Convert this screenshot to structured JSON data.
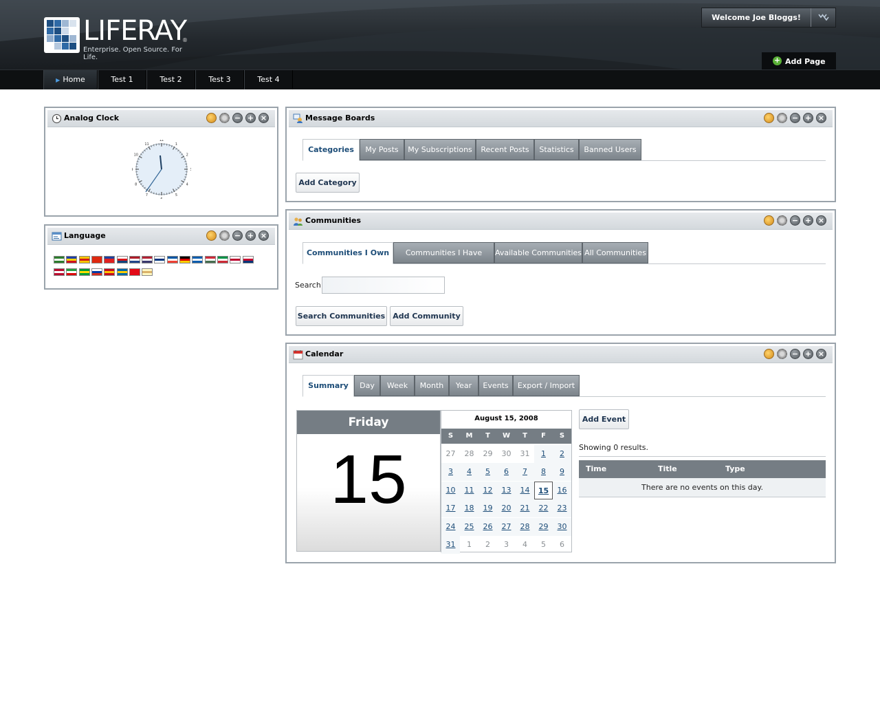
{
  "header": {
    "logo_text": "LIFERAY",
    "logo_reg": "®",
    "logo_tagline": "Enterprise. Open Source. For Life.",
    "welcome": "Welcome Joe Bloggs!",
    "add_page": "Add Page"
  },
  "nav": {
    "items": [
      {
        "label": "Home",
        "active": true
      },
      {
        "label": "Test 1"
      },
      {
        "label": "Test 2"
      },
      {
        "label": "Test 3"
      },
      {
        "label": "Test 4"
      }
    ]
  },
  "clock": {
    "title": "Analog Clock",
    "numbers": [
      "12",
      "1",
      "2",
      "3",
      "4",
      "5",
      "6",
      "7",
      "8",
      "9",
      "10",
      "11"
    ]
  },
  "language": {
    "title": "Language",
    "flags": [
      {
        "name": "flag-arabic",
        "colors": [
          "#2d7d2d",
          "#fff",
          "#2d7d2d"
        ]
      },
      {
        "name": "flag-catalan-andorra",
        "colors": [
          "#1f3fa6",
          "#f5d200",
          "#cf1020"
        ]
      },
      {
        "name": "flag-catalan",
        "colors": [
          "#f5c400",
          "#d21a1a",
          "#f5c400"
        ]
      },
      {
        "name": "flag-china",
        "colors": [
          "#de2910",
          "#de2910",
          "#de2910"
        ]
      },
      {
        "name": "flag-taiwan",
        "colors": [
          "#1d3fa0",
          "#e02020",
          "#e02020"
        ]
      },
      {
        "name": "flag-czech",
        "colors": [
          "#fff",
          "#d7141a",
          "#11457e"
        ]
      },
      {
        "name": "flag-netherlands",
        "colors": [
          "#ae1c28",
          "#fff",
          "#21468b"
        ]
      },
      {
        "name": "flag-usa",
        "colors": [
          "#b22234",
          "#fff",
          "#3c3b6e"
        ]
      },
      {
        "name": "flag-finland",
        "colors": [
          "#fff",
          "#003580",
          "#fff"
        ]
      },
      {
        "name": "flag-france",
        "colors": [
          "#0055a4",
          "#fff",
          "#ef4135"
        ]
      },
      {
        "name": "flag-germany",
        "colors": [
          "#000",
          "#dd0000",
          "#ffce00"
        ]
      },
      {
        "name": "flag-greece",
        "colors": [
          "#0d5eaf",
          "#fff",
          "#0d5eaf"
        ]
      },
      {
        "name": "flag-hungary",
        "colors": [
          "#ce2939",
          "#fff",
          "#477050"
        ]
      },
      {
        "name": "flag-italy",
        "colors": [
          "#009246",
          "#fff",
          "#ce2b37"
        ]
      },
      {
        "name": "flag-japan",
        "colors": [
          "#fff",
          "#bc002d",
          "#fff"
        ]
      },
      {
        "name": "flag-korea",
        "colors": [
          "#fff",
          "#c60c30",
          "#003478"
        ]
      },
      {
        "name": "flag-norway",
        "colors": [
          "#ba0c2f",
          "#fff",
          "#ba0c2f"
        ]
      },
      {
        "name": "flag-iran",
        "colors": [
          "#239f40",
          "#fff",
          "#da0000"
        ]
      },
      {
        "name": "flag-brazil",
        "colors": [
          "#009c3b",
          "#ffdf00",
          "#009c3b"
        ]
      },
      {
        "name": "flag-russia",
        "colors": [
          "#fff",
          "#0039a6",
          "#d52b1e"
        ]
      },
      {
        "name": "flag-spain",
        "colors": [
          "#c60b1e",
          "#ffc400",
          "#c60b1e"
        ]
      },
      {
        "name": "flag-sweden",
        "colors": [
          "#006aa7",
          "#fecc00",
          "#006aa7"
        ]
      },
      {
        "name": "flag-turkey",
        "colors": [
          "#e30a17",
          "#e30a17",
          "#e30a17"
        ]
      },
      {
        "name": "flag-vietnam",
        "colors": [
          "#fff7c0",
          "#dab26a",
          "#fff7c0"
        ]
      }
    ]
  },
  "message_boards": {
    "title": "Message Boards",
    "tabs": [
      "Categories",
      "My Posts",
      "My Subscriptions",
      "Recent Posts",
      "Statistics",
      "Banned Users"
    ],
    "add_category": "Add Category"
  },
  "communities": {
    "title": "Communities",
    "tabs": [
      "Communities I Own",
      "Communities I Have Joined",
      "Available Communities",
      "All Communities"
    ],
    "search_label": "Search",
    "search_value": "",
    "search_button": "Search Communities",
    "add_button": "Add Community"
  },
  "calendar": {
    "title": "Calendar",
    "tabs": [
      "Summary",
      "Day",
      "Week",
      "Month",
      "Year",
      "Events",
      "Export / Import"
    ],
    "day_name": "Friday",
    "day_number": "15",
    "month_header": "August 15, 2008",
    "dow": [
      "S",
      "M",
      "T",
      "W",
      "T",
      "F",
      "S"
    ],
    "weeks": [
      [
        {
          "d": "27",
          "o": 1
        },
        {
          "d": "28",
          "o": 1
        },
        {
          "d": "29",
          "o": 1
        },
        {
          "d": "30",
          "o": 1
        },
        {
          "d": "31",
          "o": 1
        },
        {
          "d": "1"
        },
        {
          "d": "2"
        }
      ],
      [
        {
          "d": "3"
        },
        {
          "d": "4"
        },
        {
          "d": "5"
        },
        {
          "d": "6"
        },
        {
          "d": "7"
        },
        {
          "d": "8"
        },
        {
          "d": "9"
        }
      ],
      [
        {
          "d": "10"
        },
        {
          "d": "11"
        },
        {
          "d": "12"
        },
        {
          "d": "13"
        },
        {
          "d": "14"
        },
        {
          "d": "15",
          "t": 1
        },
        {
          "d": "16"
        }
      ],
      [
        {
          "d": "17"
        },
        {
          "d": "18"
        },
        {
          "d": "19"
        },
        {
          "d": "20"
        },
        {
          "d": "21"
        },
        {
          "d": "22"
        },
        {
          "d": "23"
        }
      ],
      [
        {
          "d": "24"
        },
        {
          "d": "25"
        },
        {
          "d": "26"
        },
        {
          "d": "27"
        },
        {
          "d": "28"
        },
        {
          "d": "29"
        },
        {
          "d": "30"
        }
      ],
      [
        {
          "d": "31"
        },
        {
          "d": "1",
          "o": 1
        },
        {
          "d": "2",
          "o": 1
        },
        {
          "d": "3",
          "o": 1
        },
        {
          "d": "4",
          "o": 1
        },
        {
          "d": "5",
          "o": 1
        },
        {
          "d": "6",
          "o": 1
        }
      ]
    ],
    "add_event": "Add Event",
    "showing": "Showing 0 results.",
    "columns": [
      "Time",
      "Title",
      "Type"
    ],
    "empty": "There are no events on this day."
  }
}
